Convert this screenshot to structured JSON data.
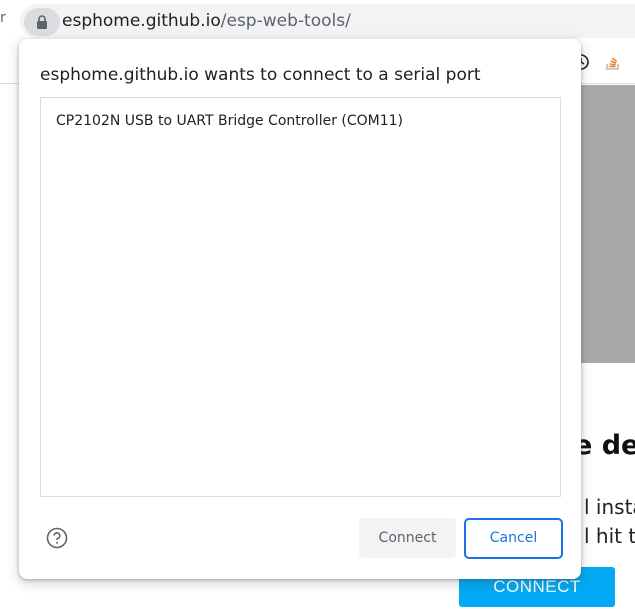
{
  "browser": {
    "left_edge_glyph": "r",
    "url_host": "esphome.github.io",
    "url_path": "/esp-web-tools/",
    "lock_icon": "lock-icon",
    "extension_icons": [
      "history-icon",
      "stack-overflow-icon"
    ]
  },
  "page": {
    "heading_fragment": "e der",
    "line1_fragment": "l instal",
    "line2_fragment": "l hit th",
    "connect_button": "CONNECT",
    "accent_color": "#03a9f4"
  },
  "dialog": {
    "title": "esphome.github.io wants to connect to a serial port",
    "ports": [
      {
        "label": "CP2102N USB to UART Bridge Controller (COM11)"
      }
    ],
    "help_icon": "help-icon",
    "connect_label": "Connect",
    "cancel_label": "Cancel",
    "primary_color": "#1a73e8"
  }
}
